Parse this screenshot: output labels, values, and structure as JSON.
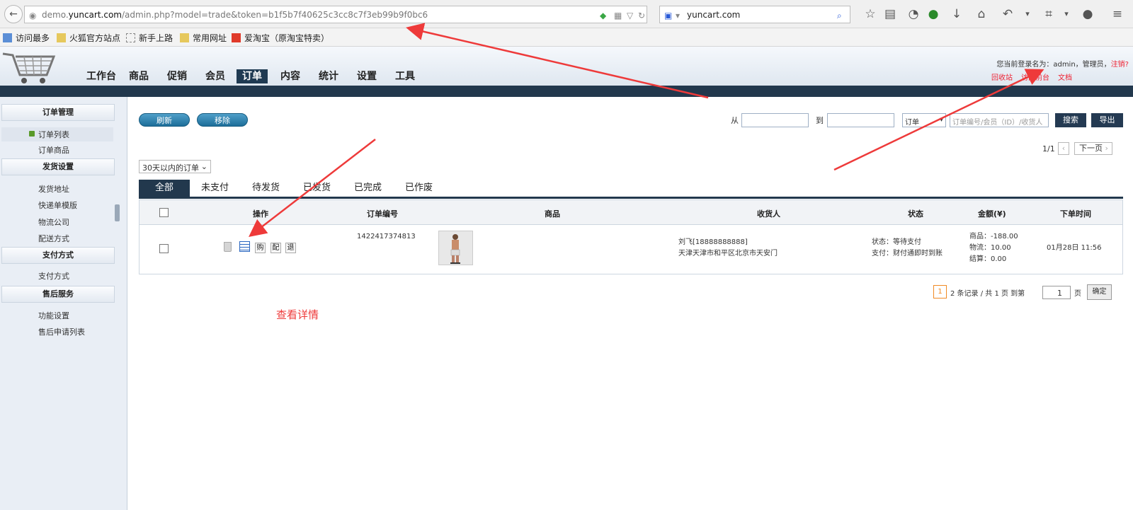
{
  "browser": {
    "url_prefix": "demo.",
    "url_domain": "yuncart.com",
    "url_rest": "/admin.php?model=trade&token=b1f5b7f40625c3cc8c7f3eb99b9f0bc6",
    "search_value": "yuncart.com",
    "bookmarks": [
      "访问最多",
      "火狐官方站点",
      "新手上路",
      "常用网址",
      "爱淘宝（原淘宝特卖）"
    ]
  },
  "header": {
    "nav": [
      "工作台",
      "商品",
      "促销",
      "会员",
      "订单",
      "内容",
      "统计",
      "设置",
      "工具"
    ],
    "active_nav": "订单",
    "login_prefix": "您当前登录名为：admin，管理员，",
    "logout": "注销?",
    "links": [
      "回收站",
      "访问前台",
      "文档"
    ]
  },
  "sidebar": {
    "sections": [
      {
        "title": "订单管理",
        "items": [
          "订单列表",
          "订单商品"
        ]
      },
      {
        "title": "发货设置",
        "items": [
          "发货地址",
          "快递单模版",
          "物流公司",
          "配送方式"
        ]
      },
      {
        "title": "支付方式",
        "items": [
          "支付方式"
        ]
      },
      {
        "title": "售后服务",
        "items": [
          "功能设置",
          "售后申请列表"
        ]
      }
    ]
  },
  "toolbar": {
    "refresh": "刷新",
    "remove": "移除",
    "from_label": "从",
    "to_label": "到",
    "type_select": "订单",
    "search_placeholder": "订单编号/会员（ID）/收货人",
    "search_btn": "搜索",
    "export_btn": "导出",
    "page_info": "1/1",
    "next_page": "下一页",
    "range_select": "30天以内的订单"
  },
  "tabs": [
    "全部",
    "未支付",
    "待发货",
    "已发货",
    "已完成",
    "已作废"
  ],
  "active_tab": "全部",
  "table": {
    "headers": [
      "操作",
      "订单编号",
      "商品",
      "收货人",
      "状态",
      "金额(¥)",
      "下单时间"
    ],
    "rows": [
      {
        "ops": [
          "购",
          "配",
          "退"
        ],
        "order_no": "1422417374813",
        "receiver_name": "刘飞[18888888888]",
        "receiver_address": "天津天津市和平区北京市天安门",
        "status_1": "状态：等待支付",
        "status_2": "支付：财付通即时到账",
        "amount_goods": "商品：-188.00",
        "amount_ship": "物流：10.00",
        "amount_total": "结算：0.00",
        "time": "01月28日 11:56"
      }
    ]
  },
  "pagination": {
    "current": "1",
    "summary": "2 条记录 / 共 1 页 到第",
    "page_input": "1",
    "page_suffix": "页",
    "confirm": "确定"
  },
  "annotation": {
    "text": "查看详情",
    "color": "#ee3a3a"
  }
}
